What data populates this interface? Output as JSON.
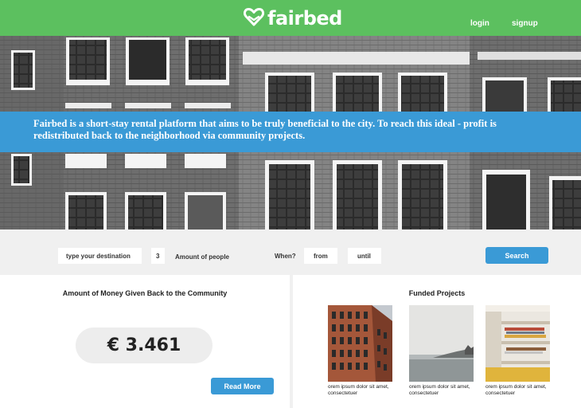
{
  "brand": {
    "name": "fairbed",
    "color": "#5cc05f",
    "accent": "#3a9ad6"
  },
  "nav": {
    "login": "login",
    "signup": "signup"
  },
  "hero": {
    "tagline": "Fairbed is a short-stay rental platform that aims to be truly beneficial to the city. To reach this ideal - profit is redistributed back to the neighborhood via community projects."
  },
  "search": {
    "destination_placeholder": "type your destination",
    "quantity": "3",
    "amount_label": "Amount of people",
    "when_label": "When?",
    "from": "from",
    "until": "until",
    "button": "Search"
  },
  "community": {
    "title": "Amount of Money Given Back to the Community",
    "amount": "€ 3.461",
    "read_more": "Read More"
  },
  "projects": {
    "title": "Funded Projects",
    "items": [
      {
        "caption": "orem ipsum dolor sit amet, consectetuer"
      },
      {
        "caption": "orem ipsum dolor sit amet, consectetuer"
      },
      {
        "caption": "orem ipsum dolor sit amet, consectetuer"
      }
    ]
  },
  "icons": {
    "logo": "heart-icon"
  }
}
